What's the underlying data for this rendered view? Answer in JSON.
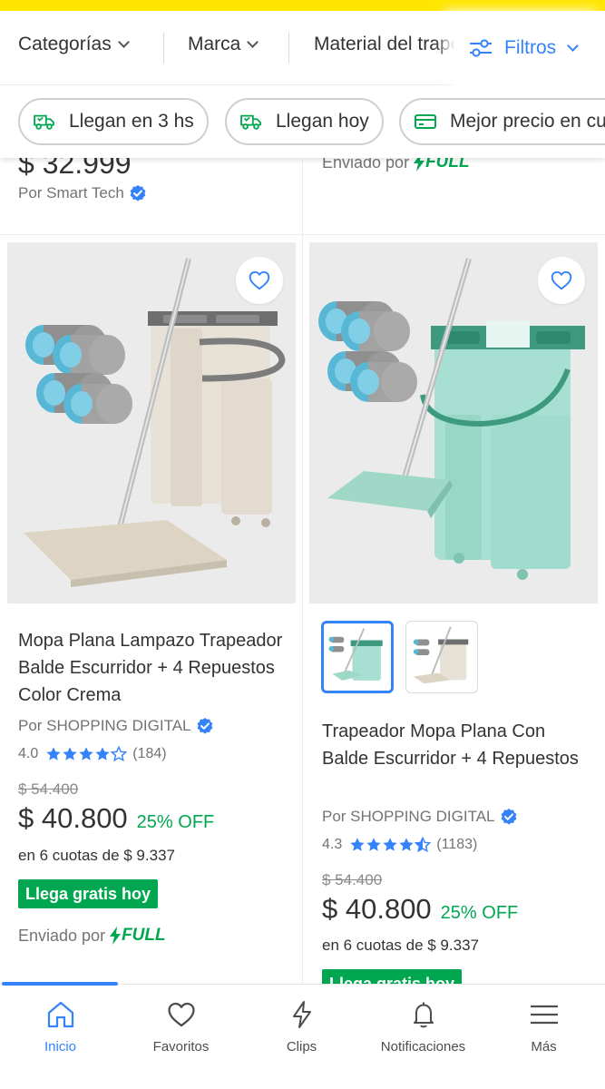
{
  "colors": {
    "brand_yellow": "#ffe600",
    "accent_blue": "#3483fa",
    "green": "#00a650"
  },
  "filters": {
    "categories": "Categorías",
    "brand": "Marca",
    "material": "Material del trapeador",
    "filters_label": "Filtros"
  },
  "chips": [
    {
      "label": "Llegan en 3 hs",
      "icon": "truck-icon"
    },
    {
      "label": "Llegan hoy",
      "icon": "truck-icon"
    },
    {
      "label": "Mejor precio en cuotas",
      "icon": "card-icon"
    }
  ],
  "previous_row": {
    "left_price": "$ 32.999",
    "left_seller": "Por Smart Tech",
    "right_shipped": "Enviado por",
    "full_label": "FULL"
  },
  "products": [
    {
      "title": "Mopa Plana Lampazo Trapeador Balde Escurridor + 4 Repuestos Color Crema",
      "seller": "Por SHOPPING DIGITAL",
      "rating": "4.0",
      "rating_value": 4.0,
      "reviews": "(184)",
      "old_price": "$ 54.400",
      "price": "$ 40.800",
      "discount": "25% OFF",
      "installments": "en 6 cuotas de $ 9.337",
      "free_shipping": "Llega gratis hoy",
      "shipped_by": "Enviado por",
      "full_label": "FULL"
    },
    {
      "title": "Trapeador Mopa Plana Con Balde Escurridor + 4 Repuestos",
      "seller": "Por SHOPPING DIGITAL",
      "rating": "4.3",
      "rating_value": 4.5,
      "reviews": "(1183)",
      "old_price": "$ 54.400",
      "price": "$ 40.800",
      "discount": "25% OFF",
      "installments": "en 6 cuotas de $ 9.337",
      "free_shipping": "Llega gratis hoy"
    }
  ],
  "bottom_nav": [
    {
      "label": "Inicio",
      "icon": "home-icon",
      "active": true
    },
    {
      "label": "Favoritos",
      "icon": "heart-icon",
      "active": false
    },
    {
      "label": "Clips",
      "icon": "clips-icon",
      "active": false
    },
    {
      "label": "Notificaciones",
      "icon": "bell-icon",
      "active": false
    },
    {
      "label": "Más",
      "icon": "menu-icon",
      "active": false
    }
  ]
}
